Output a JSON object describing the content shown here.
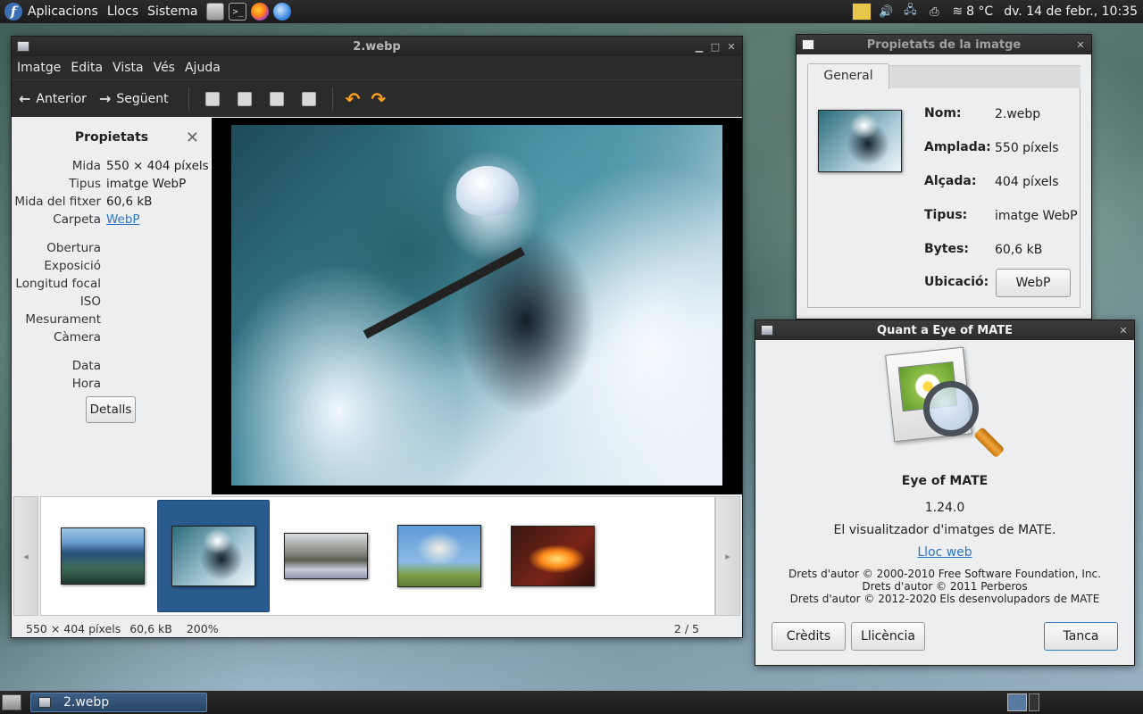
{
  "top_panel": {
    "menus": [
      "Aplicacions",
      "Llocs",
      "Sistema"
    ],
    "weather": "8 °C",
    "clock": "dv. 14 de febr., 10:35"
  },
  "viewer": {
    "title": "2.webp",
    "menus": [
      "Imatge",
      "Edita",
      "Vista",
      "Vés",
      "Ajuda"
    ],
    "toolbar": {
      "prev": "Anterior",
      "next": "Següent"
    },
    "properties": {
      "header": "Propietats",
      "rows": [
        {
          "key": "Mida",
          "value": "550 × 404 píxels"
        },
        {
          "key": "Tipus",
          "value": "imatge WebP"
        },
        {
          "key": "Mida del fitxer",
          "value": "60,6 kB"
        },
        {
          "key": "Carpeta",
          "value": "WebP"
        }
      ],
      "exif": [
        "Obertura",
        "Exposició",
        "Longitud focal",
        "ISO",
        "Mesurament",
        "Càmera"
      ],
      "datetime": [
        "Data",
        "Hora"
      ],
      "details_button": "Detalls"
    },
    "filmstrip": {
      "selected_index": 1,
      "count": 5
    },
    "status": {
      "size": "550 × 404 píxels",
      "filesize": "60,6 kB",
      "zoom": "200%",
      "position": "2 / 5"
    }
  },
  "props_dialog": {
    "title": "Propietats de la imatge",
    "tab": "General",
    "fields": [
      {
        "key": "Nom:",
        "value": "2.webp"
      },
      {
        "key": "Amplada:",
        "value": "550 píxels"
      },
      {
        "key": "Alçada:",
        "value": "404 píxels"
      },
      {
        "key": "Tipus:",
        "value": "imatge WebP"
      },
      {
        "key": "Bytes:",
        "value": "60,6 kB"
      }
    ],
    "location_label": "Ubicació:",
    "location_button": "WebP"
  },
  "about_dialog": {
    "title": "Quant a Eye of MATE",
    "name": "Eye of MATE",
    "version": "1.24.0",
    "description": "El visualitzador d'imatges de MATE.",
    "website": "Lloc web",
    "copyright": [
      "Drets d'autor © 2000-2010 Free Software Foundation, Inc.",
      "Drets d'autor © 2011 Perberos",
      "Drets d'autor © 2012-2020 Els desenvolupadors de MATE"
    ],
    "buttons": {
      "credits": "Crèdits",
      "license": "Llicència",
      "close": "Tanca"
    }
  },
  "bottom_panel": {
    "task": "2.webp"
  }
}
